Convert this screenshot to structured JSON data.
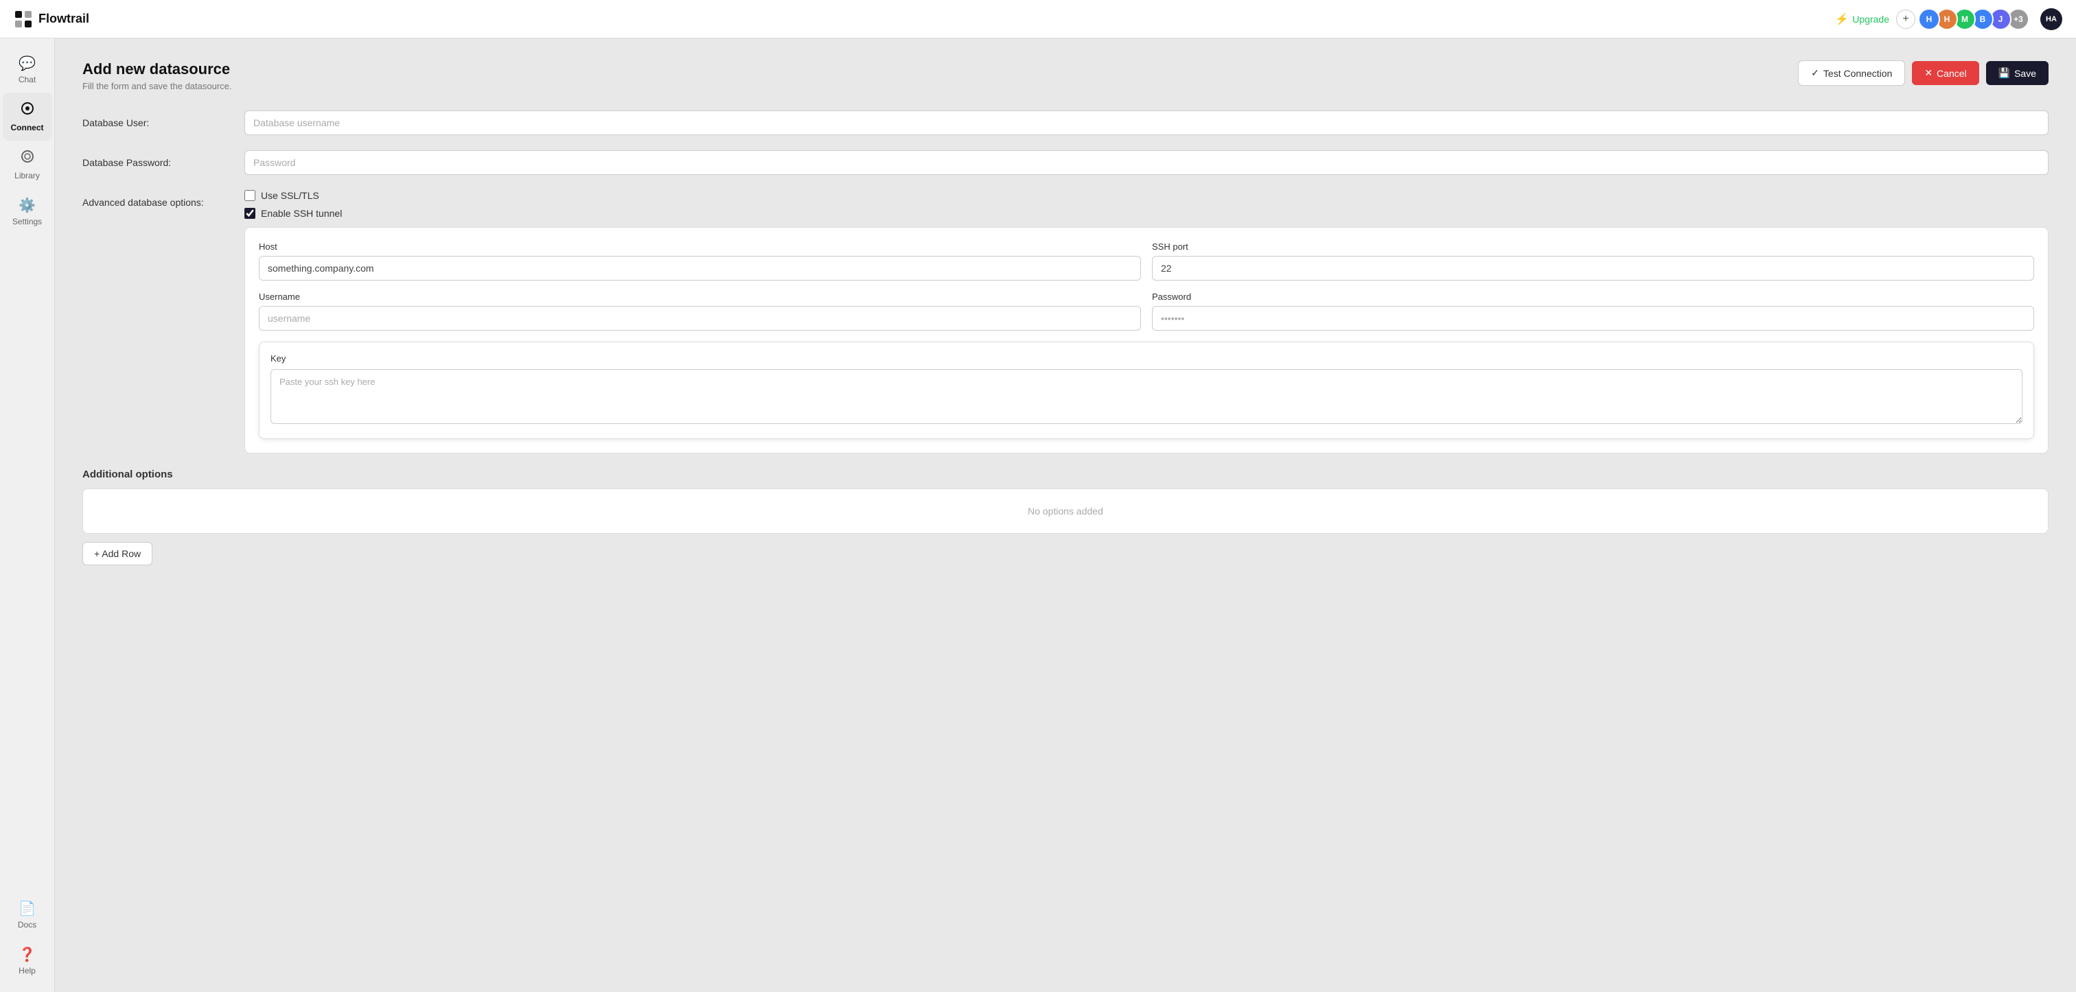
{
  "app": {
    "logo_text": "Flowtrail",
    "upgrade_label": "Upgrade"
  },
  "header": {
    "plus_label": "+",
    "avatars": [
      {
        "letter": "H",
        "color": "#3b82f6"
      },
      {
        "letter": "H",
        "color": "#e07b39"
      },
      {
        "letter": "M",
        "color": "#22c55e"
      },
      {
        "letter": "B",
        "color": "#3b82f6"
      },
      {
        "letter": "J",
        "color": "#6366f1"
      },
      {
        "letter": "+3",
        "color": "#888"
      }
    ],
    "ha_badge": "HA"
  },
  "sidebar": {
    "items": [
      {
        "id": "chat",
        "label": "Chat",
        "icon": "💬"
      },
      {
        "id": "connect",
        "label": "Connect",
        "icon": "⊙"
      },
      {
        "id": "library",
        "label": "Library",
        "icon": "◎"
      },
      {
        "id": "settings",
        "label": "Settings",
        "icon": "⚙"
      },
      {
        "id": "docs",
        "label": "Docs",
        "icon": "📄"
      },
      {
        "id": "help",
        "label": "Help",
        "icon": "?"
      }
    ],
    "active": "connect"
  },
  "form": {
    "title": "Add new datasource",
    "subtitle": "Fill the form and save the datasource.",
    "test_connection_label": "Test Connection",
    "cancel_label": "Cancel",
    "save_label": "Save",
    "db_user_label": "Database User:",
    "db_user_placeholder": "Database username",
    "db_password_label": "Database Password:",
    "db_password_placeholder": "Password",
    "advanced_label": "Advanced database options:",
    "ssl_tls_label": "Use SSL/TLS",
    "ssh_tunnel_label": "Enable SSH tunnel",
    "ssh": {
      "host_label": "Host",
      "host_value": "something.company.com",
      "port_label": "SSH port",
      "port_value": "22",
      "username_label": "Username",
      "username_placeholder": "username",
      "password_label": "Password",
      "password_placeholder": "•••••••",
      "key_label": "Key",
      "key_placeholder": "Paste your ssh key here"
    },
    "additional_options_title": "Additional options",
    "no_options_label": "No options added",
    "add_row_label": "+ Add Row"
  }
}
